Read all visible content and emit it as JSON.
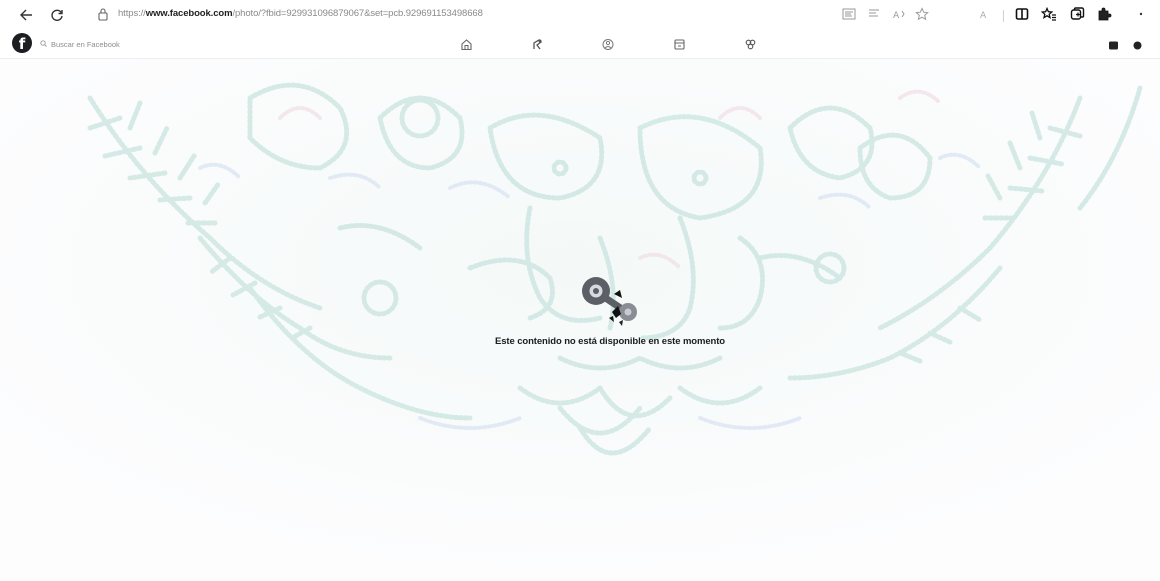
{
  "browser": {
    "url_prefix": "https://",
    "url_host": "www.facebook.com",
    "url_path": "/photo/?fbid=929931096879067&set=pcb.929691153498668",
    "icons": [
      "back-arrow-icon",
      "reload-icon",
      "site-info-icon",
      "read-aloud-icon",
      "immersive-reader-icon",
      "font-icon",
      "favorite-star-icon",
      "profile-icon",
      "split-screen-icon",
      "favorites-icon",
      "collections-icon",
      "extensions-icon",
      "more-icon"
    ]
  },
  "facebook_header": {
    "logo_letter": "f",
    "search_placeholder": "Buscar en Facebook",
    "nav": [
      "home-icon",
      "watch-icon",
      "groups-icon",
      "marketplace-icon",
      "gaming-icon"
    ]
  },
  "content": {
    "unavailable_message": "Este contenido no está disponible en este momento"
  },
  "colors": {
    "bg": "#fcfcfe",
    "pattern_teal": "#cde8e4",
    "pattern_blue": "#d9e6f2",
    "pattern_pink": "#f1e2ea"
  }
}
